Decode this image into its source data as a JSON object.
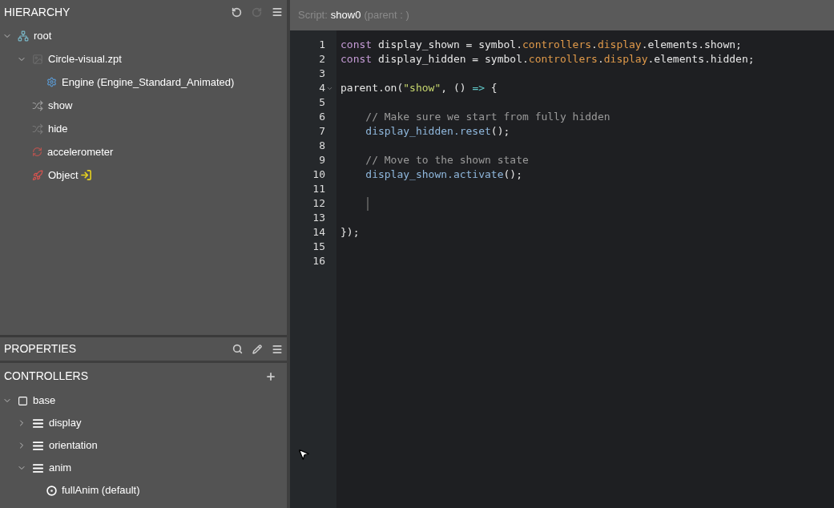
{
  "hierarchy": {
    "title": "HIERARCHY",
    "tree": [
      {
        "label": "root",
        "kind": "hierarchy",
        "expanded": true,
        "children": [
          {
            "label": "Circle-visual.zpt",
            "kind": "image",
            "expanded": true,
            "children": [
              {
                "label": "Engine (Engine_Standard_Animated)",
                "kind": "gear"
              }
            ]
          },
          {
            "label": "show",
            "kind": "shuffle"
          },
          {
            "label": "hide",
            "kind": "shuffle-dim"
          },
          {
            "label": "accelerometer",
            "kind": "refresh"
          },
          {
            "label": "Object",
            "kind": "rocket",
            "linked": true
          }
        ]
      }
    ]
  },
  "properties": {
    "title": "PROPERTIES"
  },
  "controllers": {
    "title": "CONTROLLERS",
    "tree": [
      {
        "label": "base",
        "kind": "square",
        "expanded": true,
        "children": [
          {
            "label": "display",
            "kind": "list",
            "expanded": false
          },
          {
            "label": "orientation",
            "kind": "list",
            "expanded": false
          },
          {
            "label": "anim",
            "kind": "list",
            "expanded": true,
            "children": [
              {
                "label": "fullAnim (default)",
                "kind": "target"
              }
            ]
          }
        ]
      }
    ]
  },
  "editor": {
    "label": "Script:",
    "name": "show0",
    "parent": "(parent : )",
    "lines": [
      {
        "number": "1",
        "tokens": [
          {
            "kind": "keyword",
            "text": "const"
          },
          {
            "kind": "plain",
            "text": " display_shown = symbol."
          },
          {
            "kind": "prop",
            "text": "controllers"
          },
          {
            "kind": "plain",
            "text": "."
          },
          {
            "kind": "prop",
            "text": "display"
          },
          {
            "kind": "plain",
            "text": ".elements.shown;"
          }
        ]
      },
      {
        "number": "2",
        "tokens": [
          {
            "kind": "keyword",
            "text": "const"
          },
          {
            "kind": "plain",
            "text": " display_hidden = symbol."
          },
          {
            "kind": "prop",
            "text": "controllers"
          },
          {
            "kind": "plain",
            "text": "."
          },
          {
            "kind": "prop",
            "text": "display"
          },
          {
            "kind": "plain",
            "text": ".elements.hidden;"
          }
        ]
      },
      {
        "number": "3"
      },
      {
        "number": "4",
        "foldable": true,
        "tokens": [
          {
            "kind": "plain",
            "text": "parent.on("
          },
          {
            "kind": "string",
            "text": "\"show\""
          },
          {
            "kind": "plain",
            "text": ", () "
          },
          {
            "kind": "operator",
            "text": "=>"
          },
          {
            "kind": "plain",
            "text": " {"
          }
        ]
      },
      {
        "number": "5"
      },
      {
        "number": "6",
        "tokens": [
          {
            "kind": "comment",
            "text": "    // Make sure we start from fully hidden"
          }
        ]
      },
      {
        "number": "7",
        "tokens": [
          {
            "kind": "method",
            "text": "    display_hidden.reset"
          },
          {
            "kind": "plain",
            "text": "();"
          }
        ]
      },
      {
        "number": "8"
      },
      {
        "number": "9",
        "tokens": [
          {
            "kind": "comment",
            "text": "    // Move to the shown state"
          }
        ]
      },
      {
        "number": "10",
        "tokens": [
          {
            "kind": "method",
            "text": "    display_shown.activate"
          },
          {
            "kind": "plain",
            "text": "();"
          }
        ]
      },
      {
        "number": "11"
      },
      {
        "number": "12",
        "cursor": true
      },
      {
        "number": "13"
      },
      {
        "number": "14",
        "tokens": [
          {
            "kind": "plain",
            "text": "});"
          }
        ]
      },
      {
        "number": "15"
      },
      {
        "number": "16"
      }
    ]
  }
}
